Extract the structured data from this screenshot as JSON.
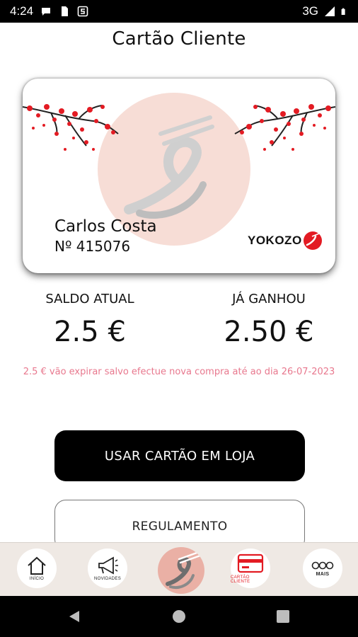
{
  "status_bar": {
    "time": "4:24",
    "network": "3G"
  },
  "header": {
    "title": "Cartão Cliente"
  },
  "card": {
    "holder_name": "Carlos Costa",
    "number": "Nº 415076",
    "brand": "YOKOZO"
  },
  "balance": {
    "current_label": "SALDO ATUAL",
    "current_value": "2.5 €",
    "earned_label": "JÁ GANHOU",
    "earned_value": "2.50 €"
  },
  "expire_note": "2.5 € vão expirar salvo efectue nova compra até ao dia 26-07-2023",
  "actions": {
    "use_card_label": "USAR CARTÃO EM LOJA",
    "rules_label": "REGULAMENTO"
  },
  "bottom_nav": {
    "items": [
      {
        "label": "INÍCIO",
        "icon": "home-icon"
      },
      {
        "label": "NOVIDADES",
        "icon": "megaphone-icon"
      },
      {
        "label": "",
        "icon": "chopsticks-logo-icon"
      },
      {
        "label": "CARTÃO CLIENTE",
        "icon": "card-icon"
      },
      {
        "label": "MAIS",
        "icon": "more-icon"
      }
    ]
  },
  "colors": {
    "accent": "#e31b23",
    "note_pink": "#e8788e",
    "nav_bg": "#efe9e4",
    "logo_circle": "#eab0a5"
  }
}
